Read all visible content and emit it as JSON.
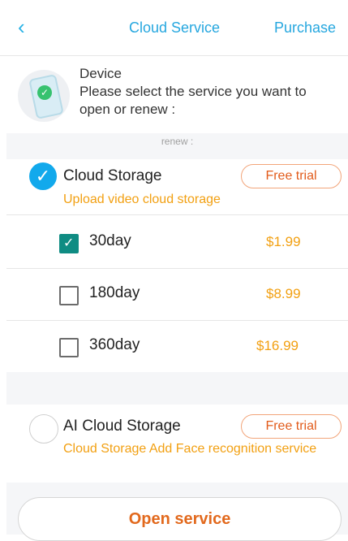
{
  "header": {
    "back_icon": "chevron-left-icon",
    "title": "Cloud Service",
    "action": "Purchase"
  },
  "device": {
    "icon": "phone-check-icon",
    "label": "Device",
    "description": "Please select the service you want to open or renew :"
  },
  "section_header": "renew :",
  "services": [
    {
      "name": "Cloud Storage",
      "selected": true,
      "badge": "Free trial",
      "description": "Upload video cloud storage",
      "options": [
        {
          "label": "30day",
          "price": "$1.99",
          "checked": true
        },
        {
          "label": "180day",
          "price": "$8.99",
          "checked": false
        },
        {
          "label": "360day",
          "price": "$16.99",
          "checked": false
        }
      ]
    },
    {
      "name": "AI Cloud Storage",
      "selected": false,
      "badge": "Free trial",
      "description": "Cloud Storage Add Face recognition service"
    }
  ],
  "bottom_button": "Open service",
  "colors": {
    "accent_blue": "#26a7df",
    "checkbox_teal": "#0f8c83",
    "price_orange": "#f2a012",
    "button_text": "#e2691d"
  }
}
